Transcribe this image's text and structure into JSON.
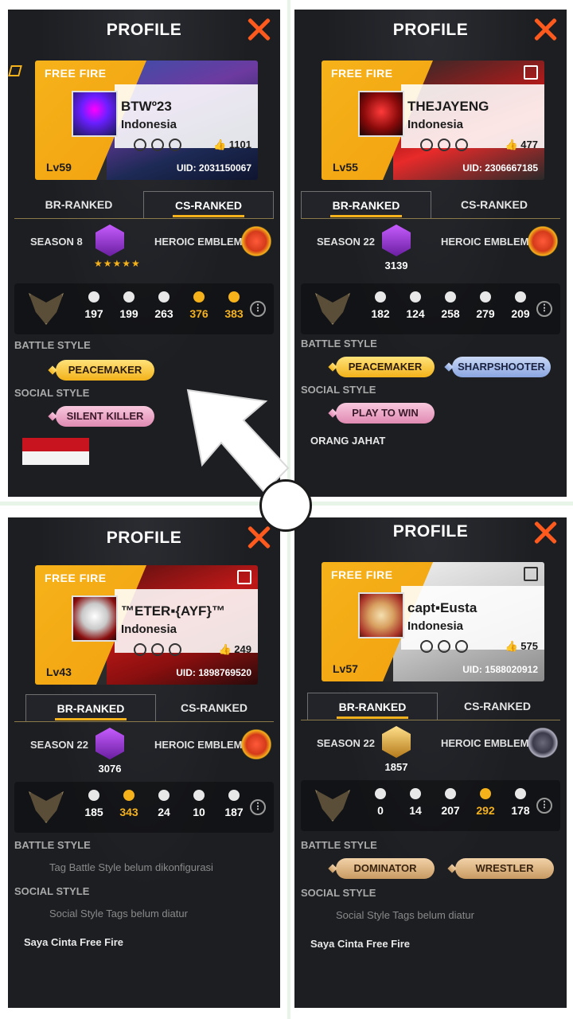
{
  "screen_title": "PROFILE",
  "brand": "FREE FIRE",
  "panels": {
    "tl": {
      "name": "BTWº23",
      "region": "Indonesia",
      "likes": "1101",
      "level": "Lv59",
      "uid": "UID: 2031150067",
      "tab_left": "BR-RANKED",
      "tab_right": "CS-RANKED",
      "active_tab": "right",
      "season": "SEASON 8",
      "rank_stars": "★★★★★",
      "emblem_label": "HEROIC EMBLEM",
      "stats": [
        "197",
        "199",
        "263",
        "376",
        "383"
      ],
      "battle_label": "BATTLE STYLE",
      "battle_tags": [
        "PEACEMAKER"
      ],
      "social_label": "SOCIAL STYLE",
      "social_tags": [
        "SILENT KILLER"
      ]
    },
    "tr": {
      "name": "THEJAYENG",
      "region": "Indonesia",
      "likes": "477",
      "level": "Lv55",
      "uid": "UID: 2306667185",
      "tab_left": "BR-RANKED",
      "tab_right": "CS-RANKED",
      "active_tab": "left",
      "season": "SEASON 22",
      "rank_score": "3139",
      "emblem_label": "HEROIC EMBLEM",
      "stats": [
        "182",
        "124",
        "258",
        "279",
        "209"
      ],
      "battle_label": "BATTLE STYLE",
      "battle_tags": [
        "PEACEMAKER",
        "SHARPSHOOTER"
      ],
      "social_label": "SOCIAL STYLE",
      "social_tags": [
        "PLAY TO WIN"
      ],
      "signature": "ORANG JAHAT"
    },
    "bl": {
      "name": "™ETER▪{AYF}™",
      "region": "Indonesia",
      "likes": "249",
      "level": "Lv43",
      "uid": "UID: 1898769520",
      "tab_left": "BR-RANKED",
      "tab_right": "CS-RANKED",
      "active_tab": "left",
      "season": "SEASON 22",
      "rank_score": "3076",
      "emblem_label": "HEROIC EMBLEM",
      "stats": [
        "185",
        "343",
        "24",
        "10",
        "187"
      ],
      "battle_label": "BATTLE STYLE",
      "battle_note": "Tag Battle Style belum dikonfigurasi",
      "social_label": "SOCIAL STYLE",
      "social_note": "Social Style Tags belum diatur",
      "signature": "Saya Cinta Free Fire"
    },
    "br": {
      "name": "capt▪Eusta",
      "region": "Indonesia",
      "likes": "575",
      "level": "Lv57",
      "uid": "UID: 1588020912",
      "tab_left": "BR-RANKED",
      "tab_right": "CS-RANKED",
      "active_tab": "left",
      "season": "SEASON 22",
      "rank_score": "1857",
      "emblem_label": "HEROIC EMBLEM",
      "stats": [
        "0",
        "14",
        "207",
        "292",
        "178"
      ],
      "battle_label": "BATTLE STYLE",
      "battle_tags": [
        "DOMINATOR",
        "WRESTLER"
      ],
      "social_label": "SOCIAL STYLE",
      "social_note": "Social Style Tags belum diatur",
      "signature": "Saya Cinta Free Fire"
    }
  },
  "colors": {
    "accent": "#f5b21a",
    "close": "#ff5a1e",
    "panel_bg": "#1c1e22"
  },
  "icons": [
    "close-icon",
    "edit-icon",
    "likes-icon",
    "more-icon",
    "rank-badge-icon",
    "heroic-emblem-icon",
    "arrow-icon"
  ]
}
